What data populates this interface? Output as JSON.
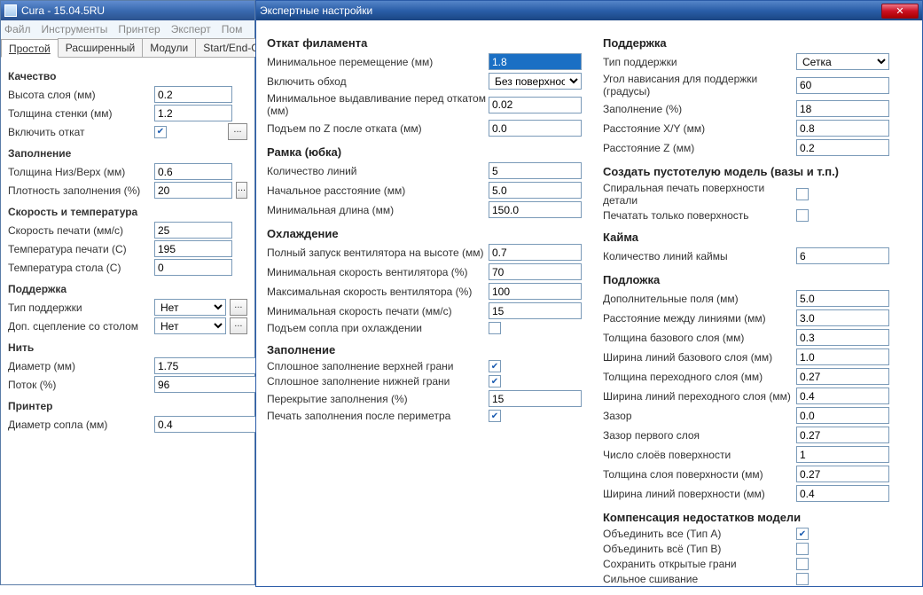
{
  "main": {
    "title": "Cura - 15.04.5RU",
    "menu": [
      "Файл",
      "Инструменты",
      "Принтер",
      "Эксперт",
      "Пом"
    ],
    "tabs": [
      "Простой",
      "Расширенный",
      "Модули",
      "Start/End-GCode"
    ],
    "active_tab": 0,
    "quality": {
      "hdr": "Качество",
      "layer_height_lbl": "Высота слоя (мм)",
      "layer_height": "0.2",
      "wall_lbl": "Толщина стенки (мм)",
      "wall": "1.2",
      "retraction_lbl": "Включить откат",
      "retraction": true
    },
    "infill": {
      "hdr": "Заполнение",
      "topbottom_lbl": "Толщина Низ/Верх (мм)",
      "topbottom": "0.6",
      "density_lbl": "Плотность заполнения (%)",
      "density": "20"
    },
    "speed": {
      "hdr": "Скорость и температура",
      "print_speed_lbl": "Скорость печати (мм/с)",
      "print_speed": "25",
      "temp_lbl": "Температура печати (C)",
      "temp": "195",
      "bed_lbl": "Температура стола (C)",
      "bed": "0"
    },
    "support": {
      "hdr": "Поддержка",
      "type_lbl": "Тип поддержки",
      "type": "Нет",
      "adhesion_lbl": "Доп. сцепление со столом",
      "adhesion": "Нет"
    },
    "filament": {
      "hdr": "Нить",
      "diameter_lbl": "Диаметр (мм)",
      "diameter": "1.75",
      "flow_lbl": "Поток (%)",
      "flow": "96"
    },
    "printer": {
      "hdr": "Принтер",
      "nozzle_lbl": "Диаметр сопла (мм)",
      "nozzle": "0.4"
    }
  },
  "expert": {
    "title": "Экспертные настройки",
    "left": {
      "retract": {
        "hdr": "Откат филамента",
        "min_travel_lbl": "Минимальное перемещение (мм)",
        "min_travel": "1.8",
        "combing_lbl": "Включить обход",
        "combing": "Без поверхности",
        "min_extrude_lbl": "Минимальное выдавливание перед откатом (мм)",
        "min_extrude": "0.02",
        "zhop_lbl": "Подъем по Z после отката (мм)",
        "zhop": "0.0"
      },
      "skirt": {
        "hdr": "Рамка (юбка)",
        "lines_lbl": "Количество линий",
        "lines": "5",
        "distance_lbl": "Начальное расстояние (мм)",
        "distance": "5.0",
        "minlen_lbl": "Минимальная длина (мм)",
        "minlen": "150.0"
      },
      "cooling": {
        "hdr": "Охлаждение",
        "full_fan_lbl": "Полный запуск вентилятора на высоте (мм)",
        "full_fan": "0.7",
        "min_fan_lbl": "Минимальная скорость вентилятора (%)",
        "min_fan": "70",
        "max_fan_lbl": "Максимальная скорость вентилятора (%)",
        "max_fan": "100",
        "min_speed_lbl": "Минимальная скорость печати (мм/с)",
        "min_speed": "15",
        "lift_lbl": "Подъем сопла при охлаждении",
        "lift": false
      },
      "infill": {
        "hdr": "Заполнение",
        "solid_top_lbl": "Сплошное заполнение верхней грани",
        "solid_top": true,
        "solid_bot_lbl": "Сплошное заполнение нижней грани",
        "solid_bot": true,
        "overlap_lbl": "Перекрытие заполнения (%)",
        "overlap": "15",
        "after_perim_lbl": "Печать заполнения после периметра",
        "after_perim": true
      }
    },
    "right": {
      "support": {
        "hdr": "Поддержка",
        "type_lbl": "Тип поддержки",
        "type": "Сетка",
        "angle_lbl": "Угол нависания для поддержки (градусы)",
        "angle": "60",
        "fill_lbl": "Заполнение (%)",
        "fill": "18",
        "xy_lbl": "Расстояние X/Y (мм)",
        "xy": "0.8",
        "z_lbl": "Расстояние Z (мм)",
        "z": "0.2"
      },
      "hollow": {
        "hdr": "Создать пустотелую модель (вазы и т.п.)",
        "spiral_lbl": "Спиральная печать поверхности детали",
        "spiral": false,
        "surface_lbl": "Печатать только поверхность",
        "surface": false
      },
      "brim": {
        "hdr": "Кайма",
        "lines_lbl": "Количество линий каймы",
        "lines": "6"
      },
      "raft": {
        "hdr": "Подложка",
        "margin_lbl": "Дополнительные поля (мм)",
        "margin": "5.0",
        "line_spacing_lbl": "Расстояние между линиями (мм)",
        "line_spacing": "3.0",
        "base_thick_lbl": "Толщина базового слоя (мм)",
        "base_thick": "0.3",
        "base_width_lbl": "Ширина линий базового слоя (мм)",
        "base_width": "1.0",
        "iface_thick_lbl": "Толщина переходного слоя (мм)",
        "iface_thick": "0.27",
        "iface_width_lbl": "Ширина линий переходного слоя (мм)",
        "iface_width": "0.4",
        "gap_lbl": "Зазор",
        "gap": "0.0",
        "first_gap_lbl": "Зазор первого слоя",
        "first_gap": "0.27",
        "surf_layers_lbl": "Число слоёв поверхности",
        "surf_layers": "1",
        "surf_thick_lbl": "Толщина слоя поверхности (мм)",
        "surf_thick": "0.27",
        "surf_width_lbl": "Ширина линий поверхности (мм)",
        "surf_width": "0.4"
      },
      "fix": {
        "hdr": "Компенсация недостатков модели",
        "a_lbl": "Объединить все (Тип A)",
        "a": true,
        "b_lbl": "Объединить всё (Тип B)",
        "b": false,
        "open_lbl": "Сохранить открытые грани",
        "open": false,
        "stitch_lbl": "Сильное сшивание",
        "stitch": false
      }
    }
  }
}
